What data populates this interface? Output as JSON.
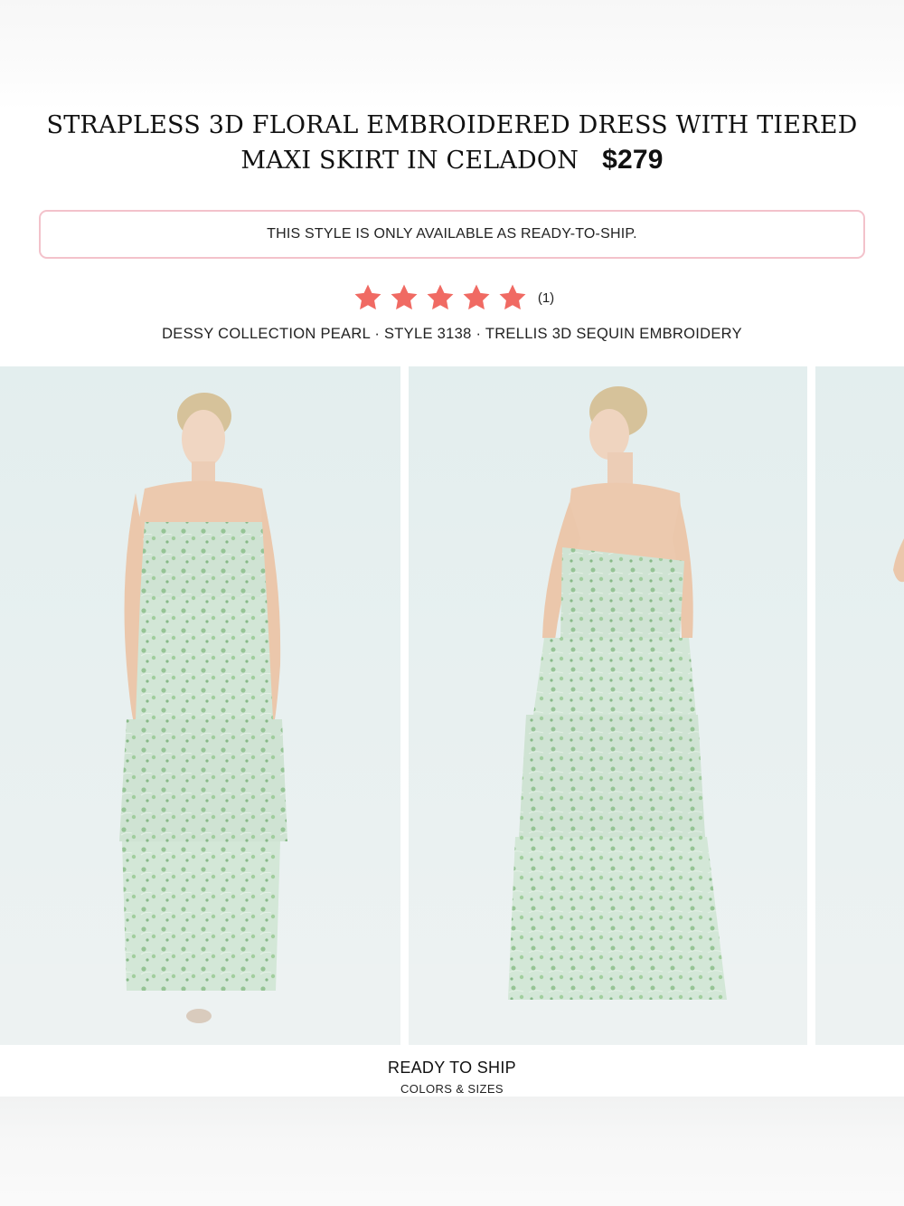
{
  "product": {
    "title": "STRAPLESS 3D FLORAL EMBROIDERED DRESS WITH TIERED MAXI SKIRT IN CELADON",
    "price": "$279"
  },
  "notice": {
    "text": "THIS STYLE IS ONLY AVAILABLE AS READY-TO-SHIP."
  },
  "rating": {
    "stars": 5,
    "max": 5,
    "review_count": "(1)",
    "star_color": "#f06a63"
  },
  "meta": {
    "line": "DESSY COLLECTION PEARL · STYLE 3138 · TRELLIS 3D SEQUIN EMBROIDERY"
  },
  "gallery": {
    "images": [
      {
        "alt": "front view"
      },
      {
        "alt": "back view"
      },
      {
        "alt": "side view partial"
      }
    ]
  },
  "labels": {
    "ready_to_ship": "READY TO SHIP",
    "colors_sizes": "COLORS & SIZES"
  },
  "colors": {
    "accent_border": "#f3c2cb",
    "dress": "#cfe3d3",
    "embroidery": "#8fc08e"
  }
}
